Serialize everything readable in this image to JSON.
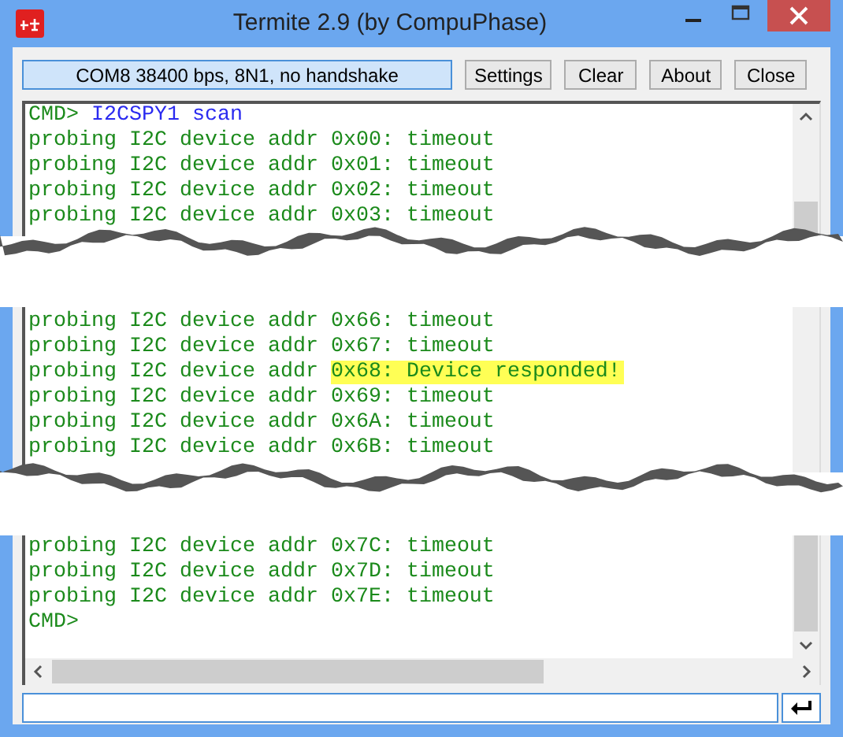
{
  "window": {
    "title": "Termite 2.9 (by CompuPhase)"
  },
  "toolbar": {
    "status": "COM8 38400 bps, 8N1, no handshake",
    "buttons": [
      "Settings",
      "Clear",
      "About",
      "Close"
    ]
  },
  "terminal": {
    "segments": [
      {
        "lines": [
          {
            "kind": "prompt",
            "prompt": "CMD>",
            "command": "I2CSPY1 scan"
          },
          {
            "kind": "output",
            "text": "probing I2C device addr 0x00: timeout"
          },
          {
            "kind": "output",
            "text": "probing I2C device addr 0x01: timeout"
          },
          {
            "kind": "output",
            "text": "probing I2C device addr 0x02: timeout"
          },
          {
            "kind": "output",
            "text": "probing I2C device addr 0x03: timeout"
          }
        ]
      },
      {
        "lines": [
          {
            "kind": "output",
            "text": "probing I2C device addr 0x66: timeout"
          },
          {
            "kind": "output",
            "text": "probing I2C device addr 0x67: timeout"
          },
          {
            "kind": "output",
            "text": "probing I2C device addr ",
            "highlight": "0x68: Device responded!"
          },
          {
            "kind": "output",
            "text": "probing I2C device addr 0x69: timeout"
          },
          {
            "kind": "output",
            "text": "probing I2C device addr 0x6A: timeout"
          },
          {
            "kind": "output",
            "text": "probing I2C device addr 0x6B: timeout"
          }
        ]
      },
      {
        "lines": [
          {
            "kind": "output",
            "text": "probing I2C device addr 0x7C: timeout"
          },
          {
            "kind": "output",
            "text": "probing I2C device addr 0x7D: timeout"
          },
          {
            "kind": "output",
            "text": "probing I2C device addr 0x7E: timeout"
          },
          {
            "kind": "prompt",
            "prompt": "CMD>"
          }
        ]
      }
    ]
  }
}
